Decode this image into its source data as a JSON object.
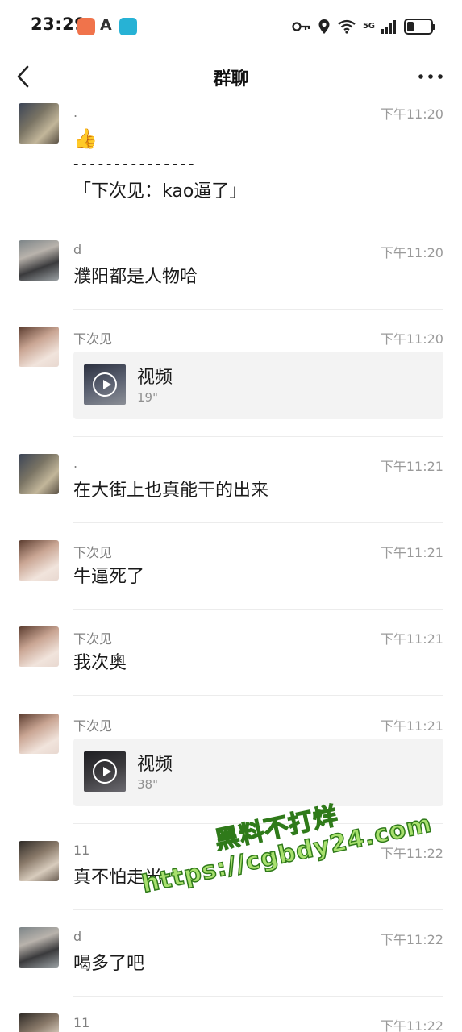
{
  "status_bar": {
    "time": "23:29",
    "network": "5G",
    "icons": [
      "key-icon",
      "location-icon",
      "wifi-icon",
      "signal-icon",
      "battery-icon"
    ],
    "app_icons": [
      "orange-app-icon",
      "a-app-icon",
      "blue-book-app-icon"
    ]
  },
  "nav": {
    "title": "群聊",
    "back_icon": "chevron-left-icon",
    "more_icon": "more-dots-icon"
  },
  "messages": [
    {
      "sender": ".",
      "time": "下午11:20",
      "emoji": "👍",
      "lines": [
        "- - - - - - - - - - - - - - -",
        "「下次见：kao逼了」"
      ],
      "avatar": "avatar-dot"
    },
    {
      "sender": "d",
      "time": "下午11:20",
      "text": "濮阳都是人物哈",
      "avatar": "avatar-d"
    },
    {
      "sender": "下次见",
      "time": "下午11:20",
      "video": {
        "title": "视频",
        "duration": "19\""
      },
      "avatar": "avatar-xcj"
    },
    {
      "sender": ".",
      "time": "下午11:21",
      "text": "在大街上也真能干的出来",
      "avatar": "avatar-dot"
    },
    {
      "sender": "下次见",
      "time": "下午11:21",
      "text": "牛逼死了",
      "avatar": "avatar-xcj"
    },
    {
      "sender": "下次见",
      "time": "下午11:21",
      "text": "我次奥",
      "avatar": "avatar-xcj"
    },
    {
      "sender": "下次见",
      "time": "下午11:21",
      "video": {
        "title": "视频",
        "duration": "38\""
      },
      "avatar": "avatar-xcj"
    },
    {
      "sender": "11",
      "time": "下午11:22",
      "text": "真不怕走光",
      "avatar": "avatar-11"
    },
    {
      "sender": "d",
      "time": "下午11:22",
      "text": "喝多了吧",
      "avatar": "avatar-d"
    },
    {
      "sender": "11",
      "time": "下午11:22",
      "text": "",
      "avatar": "avatar-11"
    }
  ],
  "watermark": {
    "line1": "黑料不打烊",
    "line2": "https://cgbdy24.com"
  },
  "colors": {
    "timestamp": "#9a9a9a",
    "sender": "#808080",
    "divider": "#ececec",
    "video_card_bg": "#f3f3f3",
    "watermark_fill": "#a8e06e"
  }
}
